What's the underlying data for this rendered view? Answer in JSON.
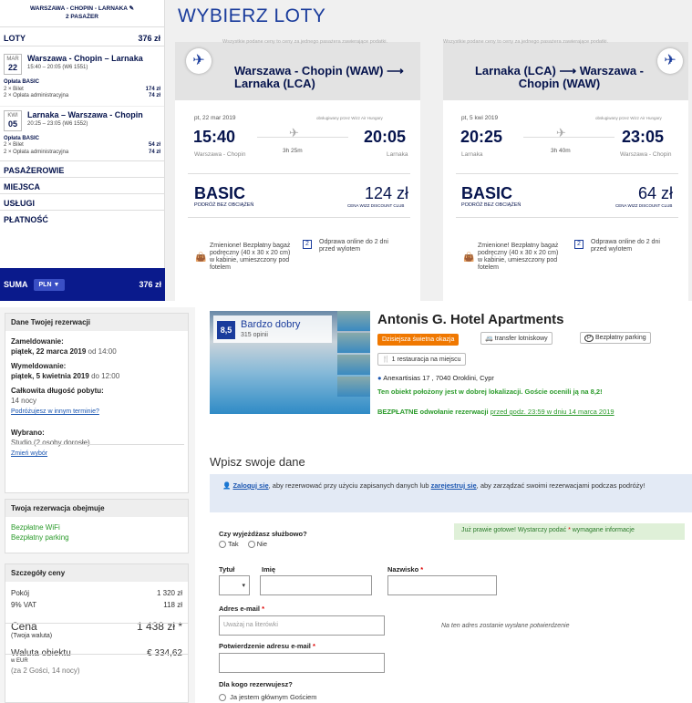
{
  "left": {
    "route_line1": "WARSZAWA - CHOPIN - LARNAKA",
    "route_line2": "2 PASAŻER",
    "loty_label": "LOTY",
    "loty_total": "376 zł",
    "flight1": {
      "month": "MAR",
      "day": "22",
      "title": "Warszawa - Chopin – Larnaka",
      "sub": "15:40 – 20:05 (W6 1551)"
    },
    "fare1_label": "Opłata BASIC",
    "fare1_rows": [
      {
        "l": "2 × Bilet",
        "v": "174 zł"
      },
      {
        "l": "2 × Opłata administracyjna",
        "v": "74 zł"
      }
    ],
    "flight2": {
      "month": "KWI",
      "day": "05",
      "title": "Larnaka – Warszawa - Chopin",
      "sub": "20:25 – 23:05 (W6 1552)"
    },
    "fare2_label": "Opłata BASIC",
    "fare2_rows": [
      {
        "l": "2 × Bilet",
        "v": "54 zł"
      },
      {
        "l": "2 × Opłata administracyjna",
        "v": "74 zł"
      }
    ],
    "acc": [
      "PASAŻEROWIE",
      "MIEJSCA",
      "USŁUGI",
      "PŁATNOŚĆ"
    ],
    "suma_label": "SUMA",
    "currency": "PLN ▼",
    "suma_total": "376 zł"
  },
  "flights": {
    "heading": "WYBIERZ LOTY",
    "note": "Wszystkie podane ceny to ceny za jednego pasażera zawierające podatki.",
    "out": {
      "route": "Warszawa - Chopin (WAW) ⟶ Larnaka (LCA)",
      "date": "pt, 22 mar 2019",
      "operated": "obsługiwany przez Wizz Air Hungary",
      "dep": "15:40",
      "arr": "20:05",
      "dep_city": "Warszawa - Chopin",
      "arr_city": "Larnaka",
      "duration": "3h 25m",
      "fare": "BASIC",
      "fare_sub": "PODRÓŻ BEZ OBCIĄŻEŃ",
      "price": "124 zł",
      "club": "CENA WIZZ DISCOUNT CLUB",
      "feat1": "Zmienione! Bezpłatny bagaż podręczny (40 x 30 x 20 cm) w kabinie, umieszczony pod fotelem",
      "feat2": "Odprawa online do 2 dni przed wylotem"
    },
    "ret": {
      "route": "Larnaka (LCA) ⟶ Warszawa - Chopin (WAW)",
      "date": "pt, 5 kwi 2019",
      "operated": "obsługiwany przez Wizz Air Hungary",
      "dep": "20:25",
      "arr": "23:05",
      "dep_city": "Larnaka",
      "arr_city": "Warszawa - Chopin",
      "duration": "3h 40m",
      "fare": "BASIC",
      "fare_sub": "PODRÓŻ BEZ OBCIĄŻEŃ",
      "price": "64 zł",
      "club": "CENA WIZZ DISCOUNT CLUB",
      "feat1": "Zmienione! Bezpłatny bagaż podręczny (40 x 30 x 20 cm) w kabinie, umieszczony pod fotelem",
      "feat2": "Odprawa online do 2 dni przed wylotem"
    }
  },
  "booking": {
    "details_h": "Dane Twojej rezerwacji",
    "checkin_l": "Zameldowanie:",
    "checkin_d": "piątek, 22 marca 2019",
    "checkin_t": "od 14:00",
    "checkout_l": "Wymeldowanie:",
    "checkout_d": "piątek, 5 kwietnia 2019",
    "checkout_t": "do 12:00",
    "stay_l": "Całkowita długość pobytu:",
    "stay_v": "14 nocy",
    "other_link": "Podróżujesz w innym terminie?",
    "chosen_l": "Wybrano:",
    "chosen_v": "Studio (2 osoby dorosłe)",
    "change_link": "Zmień wybór",
    "includes_h": "Twoja rezerwacja obejmuje",
    "inc1": "Bezpłatne WiFi",
    "inc2": "Bezpłatny parking",
    "price_h": "Szczegóły ceny",
    "room_l": "Pokój",
    "room_v": "1 320 zł",
    "vat_l": "9% VAT",
    "vat_v": "118 zł",
    "cena_l": "Cena",
    "cena_v": "1 438 zł *",
    "cena_sub": "(Twoja waluta)",
    "local_l": "Waluta obiektu",
    "local_v": "€ 334,62",
    "local_sub": "w EUR",
    "guests": "(za 2 Gości, 14 nocy)"
  },
  "hotel": {
    "score": "8,5",
    "rating": "Bardzo dobry",
    "reviews": "315 opinii",
    "name": "Antonis G. Hotel Apartments",
    "deal": "Dzisiejsza świetna okazja",
    "transfer": "transfer lotniskowy",
    "parking": "Bezpłatny parking",
    "restaurant": "1 restauracja na miejscu",
    "address": "Anexartisias 17 , 7040 Oroklini, Cypr",
    "location": "Ten obiekt położony jest w dobrej lokalizacji. Goście ocenili ją na 8,2!",
    "cancel_bold": "BEZPŁATNE odwołanie rezerwacji",
    "cancel_rest": "przed godz. 23:59 w dniu 14 marca 2019"
  },
  "form": {
    "heading": "Wpisz swoje dane",
    "login_link": "Zaloguj się",
    "login_text1": ", aby rezerwować przy użyciu zapisanych danych lub ",
    "register_link": "zarejestruj się",
    "login_text2": ", aby zarządzać swoimi rezerwacjami podczas podróży!",
    "ready": "Już prawie gotowe! Wystarczy podać",
    "ready2": "wymagane informacje",
    "business_q": "Czy wyjeżdżasz służbowo?",
    "yes": "Tak",
    "no": "Nie",
    "title_l": "Tytuł",
    "first_l": "Imię",
    "last_l": "Nazwisko",
    "email_l": "Adres e-mail",
    "email_ph": "Uważaj na literówki",
    "email_note": "Na ten adres zostanie wysłane potwierdzenie",
    "email2_l": "Potwierdzenie adresu e-mail",
    "for_whom": "Dla kogo rezerwujesz?",
    "main_guest": "Ja jestem głównym Gościem"
  }
}
